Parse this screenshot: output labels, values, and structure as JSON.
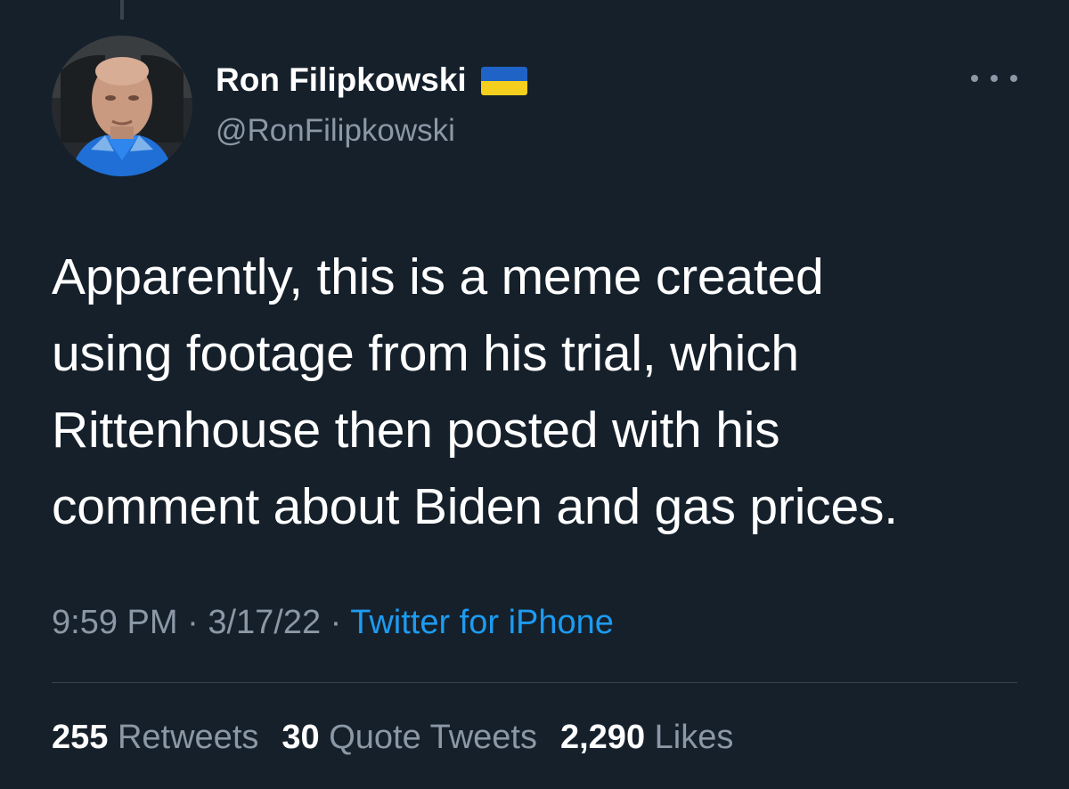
{
  "author": {
    "name": "Ron Filipkowski",
    "handle": "@RonFilipkowski",
    "flag_icon": "ukraine-flag-icon"
  },
  "colors": {
    "background": "#15202b",
    "text": "#ffffff",
    "secondary_text": "#8b98a5",
    "link": "#1d9bf0",
    "divider": "#38444d"
  },
  "tweet": {
    "lines": [
      "Apparently, this is a meme created",
      "using footage from his trial, which",
      "Rittenhouse then posted with his",
      "comment about Biden and gas prices."
    ]
  },
  "meta": {
    "time": "9:59 PM",
    "separator": "·",
    "date": "3/17/22",
    "source": "Twitter for iPhone"
  },
  "stats": {
    "retweets": {
      "count": "255",
      "label": "Retweets"
    },
    "quote_tweets": {
      "count": "30",
      "label": "Quote Tweets"
    },
    "likes": {
      "count": "2,290",
      "label": "Likes"
    }
  }
}
